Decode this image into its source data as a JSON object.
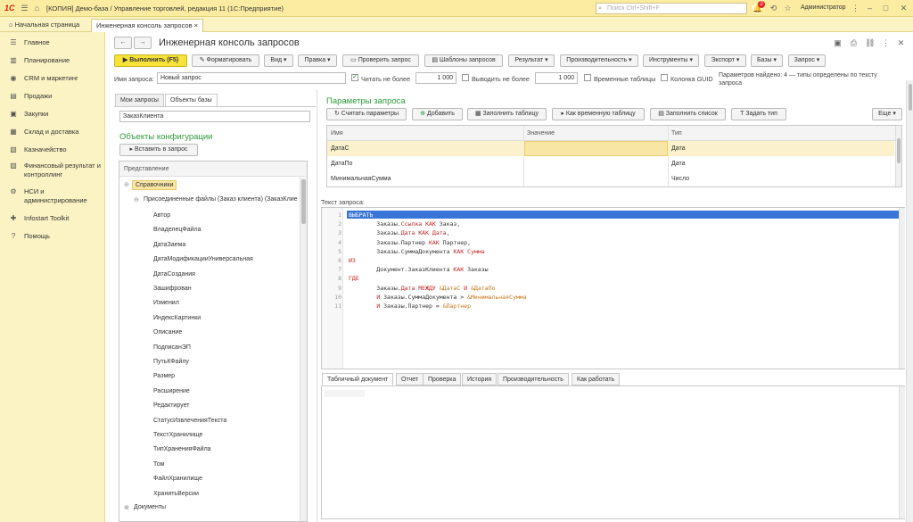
{
  "window": {
    "logo": "1С",
    "title": "[КОПИЯ] Демо-база / Управление торговлей, редакция 11  (1С:Предприятие)",
    "search_placeholder": "Поиск Ctrl+Shift+F",
    "notifications_count": "2",
    "user": "Администратор"
  },
  "tabs": {
    "home": "Начальная страница",
    "active": "Инженерная консоль запросов",
    "close": "×"
  },
  "sidebar": {
    "items": [
      {
        "label": "Главное",
        "icon": "menu-icon"
      },
      {
        "label": "Планирование",
        "icon": "chart-icon"
      },
      {
        "label": "CRM и маркетинг",
        "icon": "crm-icon"
      },
      {
        "label": "Продажи",
        "icon": "cart-icon"
      },
      {
        "label": "Закупки",
        "icon": "truck-icon"
      },
      {
        "label": "Склад и доставка",
        "icon": "warehouse-icon"
      },
      {
        "label": "Казначейство",
        "icon": "treasury-icon"
      },
      {
        "label": "Финансовый результат и контроллинг",
        "icon": "finance-icon"
      },
      {
        "label": "НСИ и администрирование",
        "icon": "settings-icon"
      },
      {
        "label": "Infostart Toolkit",
        "icon": "toolkit-icon"
      },
      {
        "label": "Помощь",
        "icon": "help-icon"
      }
    ]
  },
  "form": {
    "title": "Инженерная консоль запросов",
    "nav_back": "←",
    "nav_forward": "→",
    "toolbar": {
      "execute": "Выполнить (F5)",
      "format": "Форматировать",
      "view": "Вид",
      "edit": "Правка",
      "check": "Проверить запрос",
      "templates": "Шаблоны запросов",
      "result": "Результат",
      "performance": "Производительность",
      "tools": "Инструменты",
      "export": "Экспорт",
      "bases": "Базы",
      "query": "Запрос"
    },
    "query_name_label": "Имя запроса:",
    "query_name_value": "Новый запрос",
    "read_limit_label": "Читать не более",
    "read_limit_value": "1 000",
    "output_limit_label": "Выводить не более",
    "output_limit_value": "1 000",
    "temp_tables_label": "Временные таблицы",
    "guid_label": "Колонка GUID",
    "params_found": "Параметров найдено: 4 — типы определены по тексту запроса"
  },
  "left": {
    "tab_my": "Мои запросы",
    "tab_objects": "Объекты базы",
    "search_value": "ЗаказКлиента",
    "section_title": "Объекты конфигурации",
    "insert_button": "Вставить в запрос",
    "tree_header": "Представление",
    "tree": {
      "catalogs": "Справочники",
      "attached": "Присоединенные файлы (Заказ клиента) (ЗаказКлие",
      "fields": [
        "Автор",
        "ВладелецФайла",
        "ДатаЗаема",
        "ДатаМодификацииУниверсальная",
        "ДатаСоздания",
        "Зашифрован",
        "Изменил",
        "ИндексКартинки",
        "Описание",
        "ПодписанЭП",
        "ПутьКФайлу",
        "Размер",
        "Расширение",
        "Редактирует",
        "СтатусИзвлеченияТекста",
        "ТекстХранилище",
        "ТипХраненияФайла",
        "Том",
        "ФайлХранилище",
        "ХранитьВерсии"
      ],
      "documents": "Документы"
    }
  },
  "params": {
    "title": "Параметры запроса",
    "buttons": {
      "count": "Считать параметры",
      "add": "Добавить",
      "fill_table": "Заполнить таблицу",
      "as_temp": "Как временную таблицу",
      "fill_list": "Заполнить список",
      "set_type": "Задать тип",
      "more": "Еще"
    },
    "columns": [
      "Имя",
      "Значение",
      "Тип"
    ],
    "rows": [
      {
        "name": "ДатаС",
        "value": "",
        "type": "Дата"
      },
      {
        "name": "ДатаПо",
        "value": "",
        "type": "Дата"
      },
      {
        "name": "МинимальнаяСумма",
        "value": "",
        "type": "Число"
      }
    ]
  },
  "query_text_label": "Текст запроса:",
  "code_lines": [
    {
      "n": "1",
      "html": "<span class='kw'>ВЫБРАТЬ</span>"
    },
    {
      "n": "2",
      "html": "        Заказы.<span class='kw'>Ссылка КАК</span> Заказ,"
    },
    {
      "n": "3",
      "html": "        Заказы.<span class='kw'>Дата КАК Дата</span>,"
    },
    {
      "n": "4",
      "html": "        Заказы.Партнер <span class='kw'>КАК</span> Партнер,"
    },
    {
      "n": "5",
      "html": "        Заказы.СуммаДокумента <span class='kw'>КАК Сумма</span>"
    },
    {
      "n": "6",
      "html": "<span class='kw'>ИЗ</span>"
    },
    {
      "n": "7",
      "html": "        Документ.ЗаказКлиента <span class='kw'>КАК</span> Заказы"
    },
    {
      "n": "8",
      "html": "<span class='kw'>ГДЕ</span>"
    },
    {
      "n": "9",
      "html": "        Заказы.<span class='kw'>Дата МЕЖДУ</span> <span class='pm'>&amp;ДатаС</span> <span class='kw'>И</span> <span class='pm'>&amp;ДатаПо</span>"
    },
    {
      "n": "10",
      "html": "        <span class='kw'>И</span> Заказы.СуммаДокумента &gt; <span class='pm'>&amp;МинимальнаяСумма</span>"
    },
    {
      "n": "11",
      "html": "        <span class='kw'>И</span> Заказы.Партнер = <span class='pm'>&amp;Партнер</span>"
    }
  ],
  "bottom_tabs": [
    "Табличный документ",
    "Отчет",
    "Проверка",
    "История",
    "Производительность",
    "Как работать"
  ],
  "colors": {
    "accent": "#f7e23a",
    "section_green": "#2e9b3a",
    "keyword": "#c02323",
    "param": "#c47618",
    "selection": "#3875d7"
  }
}
